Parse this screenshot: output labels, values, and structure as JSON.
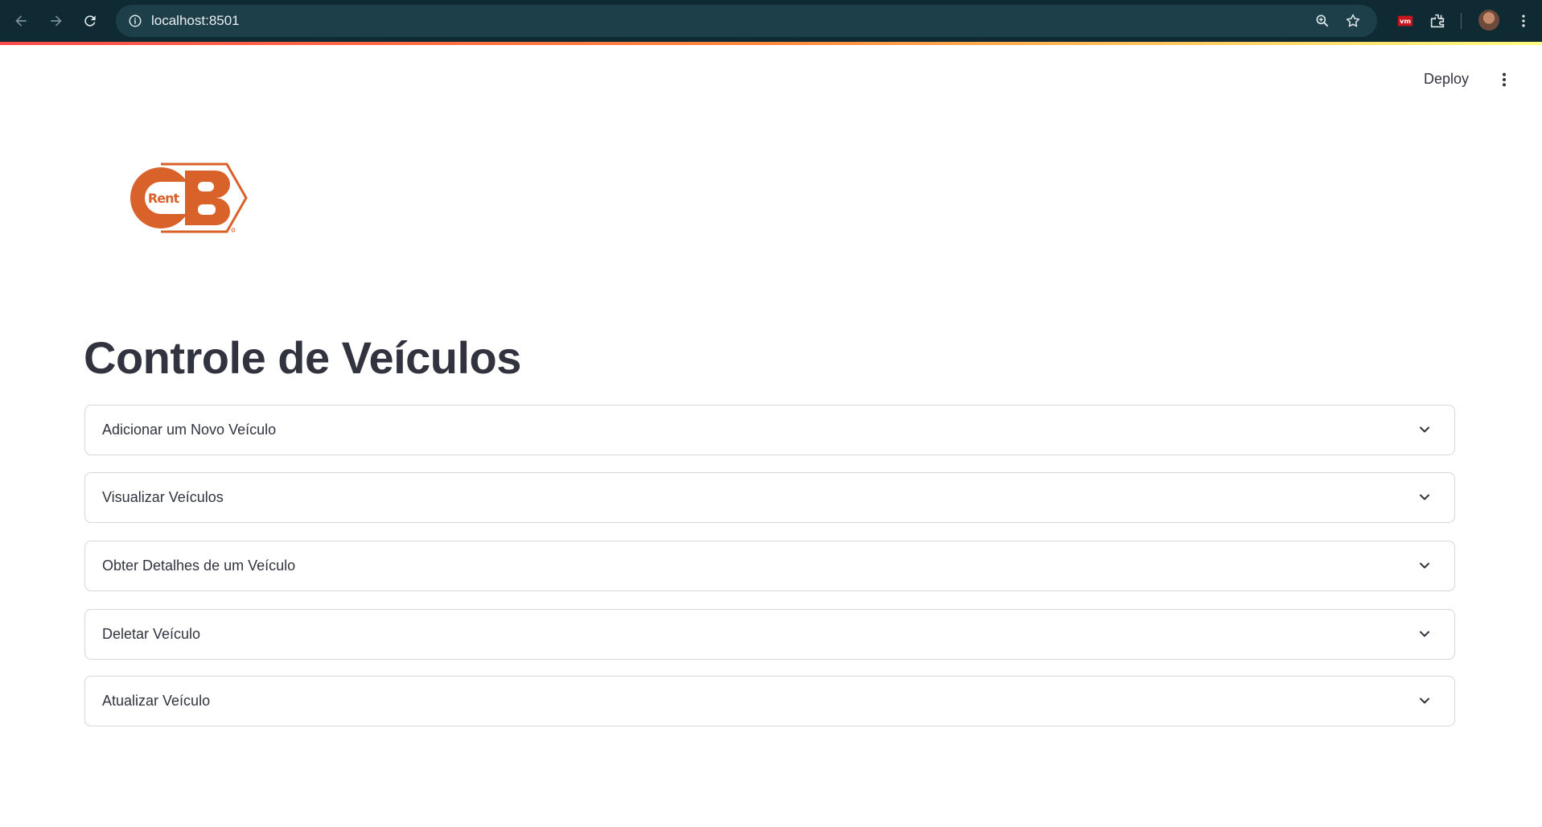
{
  "browser": {
    "url": "localhost:8501",
    "icons": [
      "back-arrow-icon",
      "forward-arrow-icon",
      "reload-icon",
      "site-info-icon",
      "zoom-icon",
      "bookmark-star-icon",
      "extension-red-icon",
      "extensions-puzzle-icon",
      "profile-avatar",
      "browser-menu-icon"
    ]
  },
  "header": {
    "deploy_label": "Deploy",
    "menu_icon": "kebab-menu-icon"
  },
  "logo": {
    "text_main": "CB",
    "text_small": "Rent",
    "color": "#d9622b"
  },
  "page": {
    "title": "Controle de Veículos"
  },
  "expanders": [
    {
      "label": "Adicionar um Novo Veículo"
    },
    {
      "label": "Visualizar Veículos"
    },
    {
      "label": "Obter Detalhes de um Veículo"
    },
    {
      "label": "Deletar Veículo"
    },
    {
      "label": "Atualizar Veículo"
    }
  ],
  "colors": {
    "chrome_bg": "#0f2a33",
    "text": "#31333f",
    "border": "#d6d6d9",
    "accent_stripe": [
      "#ff4b4b",
      "#fffd80"
    ]
  }
}
